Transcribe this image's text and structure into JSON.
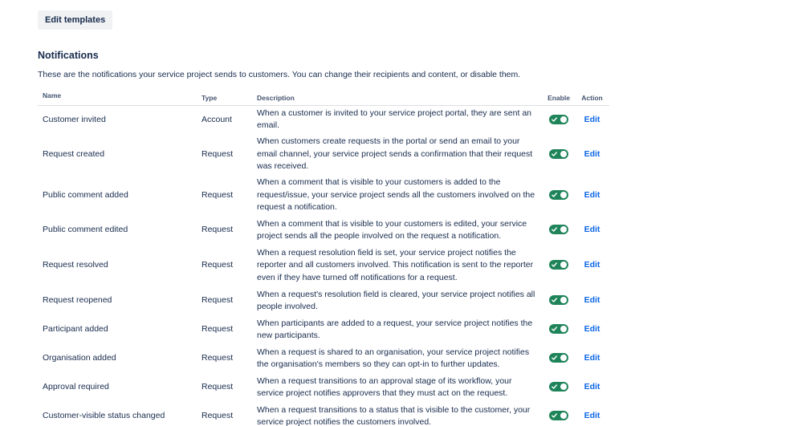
{
  "toolbar": {
    "edit_templates_label": "Edit templates"
  },
  "notifications": {
    "title": "Notifications",
    "description": "These are the notifications your service project sends to customers. You can change their recipients and content, or disable them."
  },
  "table": {
    "headers": {
      "name": "Name",
      "type": "Type",
      "description": "Description",
      "enable": "Enable",
      "action": "Action"
    },
    "rows": [
      {
        "name": "Customer invited",
        "type": "Account",
        "description": "When a customer is invited to your service project portal, they are sent an email.",
        "enabled": true,
        "action": "Edit"
      },
      {
        "name": "Request created",
        "type": "Request",
        "description": "When customers create requests in the portal or send an email to your email channel, your service project sends a confirmation that their request was received.",
        "enabled": true,
        "action": "Edit"
      },
      {
        "name": "Public comment added",
        "type": "Request",
        "description": "When a comment that is visible to your customers is added to the request/issue, your service project sends all the customers involved on the request a notification.",
        "enabled": true,
        "action": "Edit"
      },
      {
        "name": "Public comment edited",
        "type": "Request",
        "description": "When a comment that is visible to your customers is edited, your service project sends all the people involved on the request a notification.",
        "enabled": true,
        "action": "Edit"
      },
      {
        "name": "Request resolved",
        "type": "Request",
        "description": "When a request resolution field is set, your service project notifies the reporter and all customers involved. This notification is sent to the reporter even if they have turned off notifications for a request.",
        "enabled": true,
        "action": "Edit"
      },
      {
        "name": "Request reopened",
        "type": "Request",
        "description": "When a request's resolution field is cleared, your service project notifies all people involved.",
        "enabled": true,
        "action": "Edit"
      },
      {
        "name": "Participant added",
        "type": "Request",
        "description": "When participants are added to a request, your service project notifies the new participants.",
        "enabled": true,
        "action": "Edit"
      },
      {
        "name": "Organisation added",
        "type": "Request",
        "description": "When a request is shared to an organisation, your service project notifies the organisation's members so they can opt-in to further updates.",
        "enabled": true,
        "action": "Edit"
      },
      {
        "name": "Approval required",
        "type": "Request",
        "description": "When a request transitions to an approval stage of its workflow, your service project notifies approvers that they must act on the request.",
        "enabled": true,
        "action": "Edit"
      },
      {
        "name": "Customer-visible status changed",
        "type": "Request",
        "description": "When a request transitions to a status that is visible to the customer, your service project notifies the customers involved.",
        "enabled": true,
        "action": "Edit"
      }
    ]
  },
  "colors": {
    "toggle_on": "#1f845a",
    "link": "#0c66e4",
    "text": "#172b4d"
  },
  "icons": {
    "toggle_check": "check-icon"
  }
}
